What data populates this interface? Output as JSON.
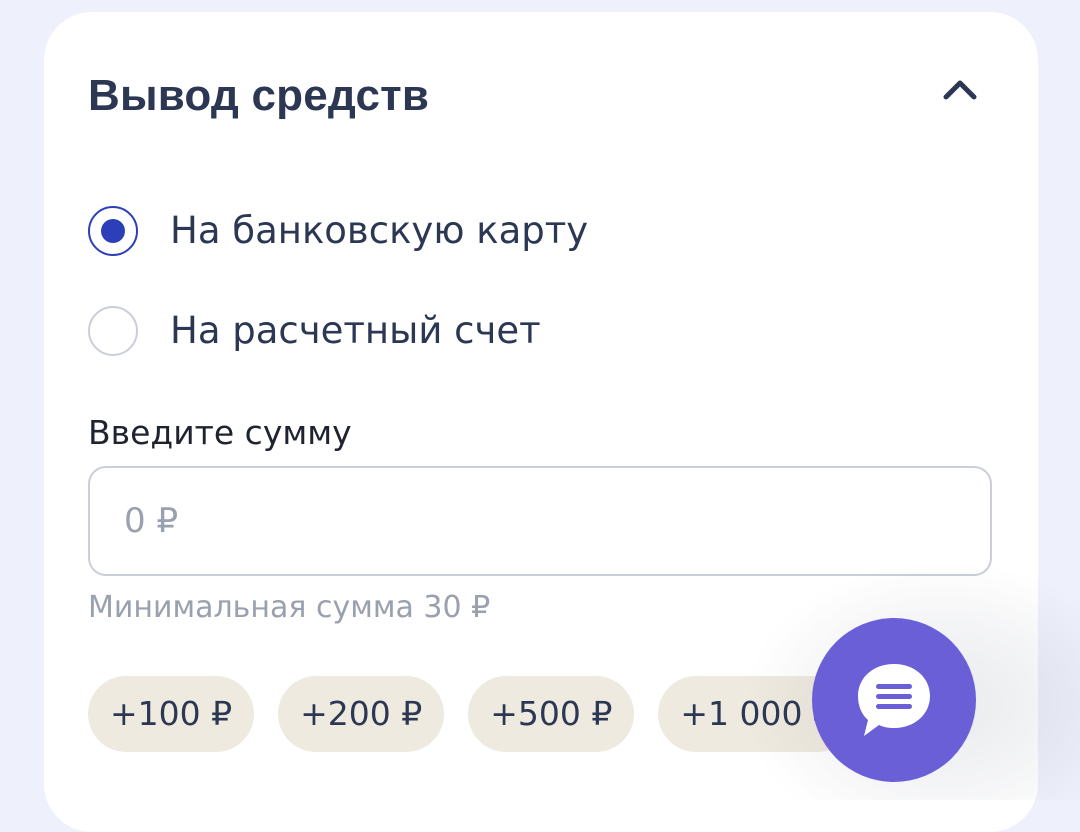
{
  "withdraw": {
    "title": "Вывод средств",
    "methods": [
      {
        "label": "На банковскую карту",
        "selected": true
      },
      {
        "label": "На расчетный счет",
        "selected": false
      }
    ],
    "amount_label": "Введите сумму",
    "amount_placeholder": "0 ₽",
    "min_hint": "Минимальная сумма 30 ₽",
    "quick_amounts": [
      "+100 ₽",
      "+200 ₽",
      "+500 ₽",
      "+1 000 ₽"
    ]
  },
  "icons": {
    "collapse": "chevron-up-icon",
    "chat": "chat-icon"
  },
  "colors": {
    "page_bg": "#eef1fb",
    "card_bg": "#ffffff",
    "text_primary": "#2c3853",
    "accent_radio": "#2c3fb8",
    "chip_bg": "#efeadf",
    "fab_bg": "#6a5fd6",
    "hint_text": "#9aa1ae"
  }
}
